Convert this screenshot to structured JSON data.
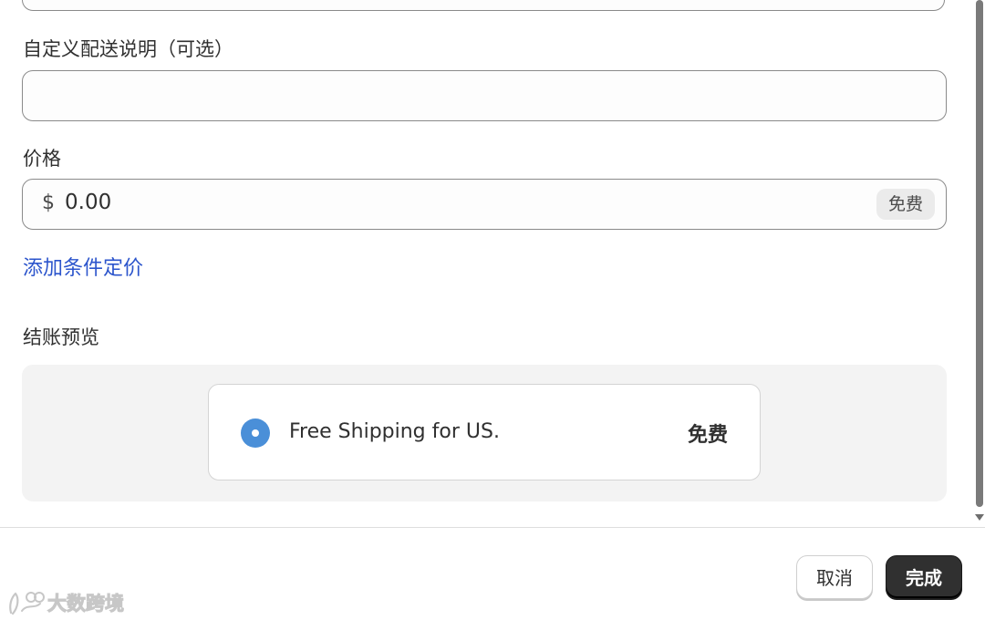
{
  "form": {
    "custom_description_label": "自定义配送说明（可选）",
    "custom_description_value": "",
    "price_label": "价格",
    "currency_symbol": "$",
    "price_value": "0.00",
    "price_badge": "免费",
    "add_conditional_pricing_link": "添加条件定价"
  },
  "preview": {
    "label": "结账预览",
    "rate_name": "Free Shipping for US.",
    "rate_price": "免费",
    "radio_selected": true,
    "radio_color": "#4a8fd8"
  },
  "footer": {
    "cancel_label": "取消",
    "done_label": "完成"
  },
  "watermark": {
    "text": "大数跨境"
  },
  "colors": {
    "link": "#2c55cc",
    "primary_button": "#303030",
    "preview_background": "#f3f3f3"
  },
  "icons": {
    "radio": "radio-selected-icon",
    "scroll_down": "scroll-down-arrow-icon",
    "watermark_logo": "watermark-logo-icon"
  }
}
